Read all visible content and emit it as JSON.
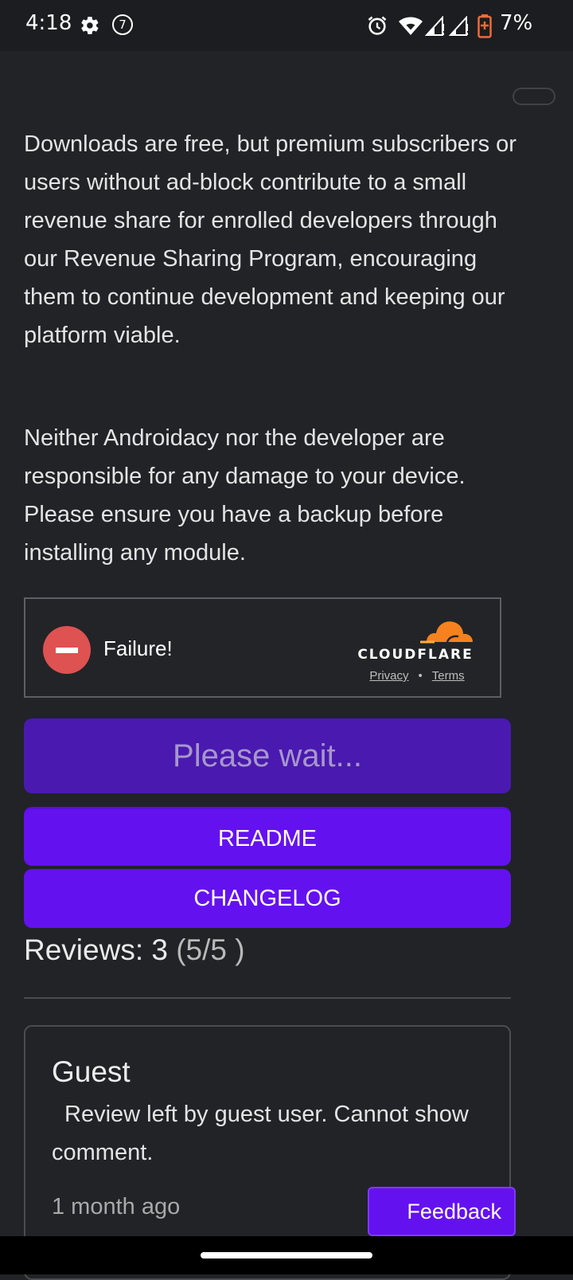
{
  "status_bar": {
    "time": "4:18",
    "notification_count": "7",
    "battery_percent": "7%",
    "icons": [
      "gear-icon",
      "alarm-icon",
      "wifi-icon",
      "signal-icon",
      "battery-icon"
    ],
    "battery_color": "#f06a3a"
  },
  "content": {
    "paragraph_1": "Downloads are free, but premium subscribers or users without ad-block contribute to a small revenue share for enrolled developers through our Revenue Sharing Program, encouraging them to continue development and keeping our platform viable.",
    "paragraph_2": "Neither Androidacy nor the developer are responsible for any damage to your device. Please ensure you have a backup before installing any module."
  },
  "captcha": {
    "status": "Failure!",
    "brand": "CLOUDFLARE",
    "privacy_link": "Privacy",
    "separator": "•",
    "terms_link": "Terms",
    "brand_color": "#f6821f"
  },
  "buttons": {
    "wait": "Please wait...",
    "readme": "README",
    "changelog": "CHANGELOG",
    "accent_color": "#6411f0"
  },
  "reviews": {
    "label": "Reviews: 3",
    "score": "(5/5 )",
    "items": [
      {
        "author": "Guest",
        "text": "Review left by guest user. Cannot show comment.",
        "time": "1 month ago"
      }
    ]
  },
  "feedback": {
    "label": "Feedback"
  }
}
